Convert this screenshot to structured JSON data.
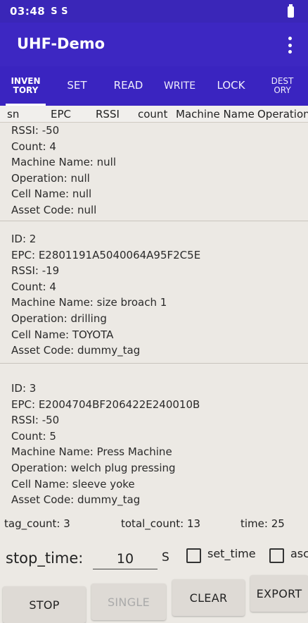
{
  "status_bar": {
    "time": "03:48",
    "notif_icons": "S S"
  },
  "app": {
    "title": "UHF-Demo"
  },
  "tabs": [
    {
      "label": "INVEN\nTORY",
      "active": true
    },
    {
      "label": "SET"
    },
    {
      "label": "READ"
    },
    {
      "label": "WRITE"
    },
    {
      "label": "LOCK"
    },
    {
      "label": "DEST\nORY"
    }
  ],
  "columns": [
    "sn",
    "EPC",
    "RSSI",
    "count",
    "Machine Name",
    "Operation"
  ],
  "records": [
    {
      "lines": [
        "RSSI: -50",
        "Count: 4",
        "Machine Name: null",
        "Operation: null",
        "Cell Name: null",
        "Asset Code: null"
      ]
    },
    {
      "lines": [
        "ID: 2",
        "EPC: E2801191A5040064A95F2C5E",
        "RSSI: -19",
        "Count: 4",
        "Machine Name: size broach 1",
        "Operation: drilling",
        "Cell Name: TOYOTA",
        "Asset Code: dummy_tag"
      ]
    },
    {
      "lines": [
        "ID: 3",
        "EPC: E2004704BF206422E240010B",
        "RSSI: -50",
        "Count: 5",
        "Machine Name: Press Machine",
        "Operation: welch plug pressing",
        "Cell Name: sleeve yoke",
        "Asset Code: dummy_tag"
      ]
    }
  ],
  "footer": {
    "tag_count": "tag_count:  3",
    "total_count": "total_count:  13",
    "time": "time:  25"
  },
  "stop": {
    "label": "stop_time:",
    "value": "10",
    "unit": "S",
    "set_time_label": "set_time",
    "asc_label": "asc"
  },
  "buttons": {
    "stop": "STOP",
    "single": "SINGLE",
    "clear": "CLEAR",
    "export": "EXPORT"
  }
}
